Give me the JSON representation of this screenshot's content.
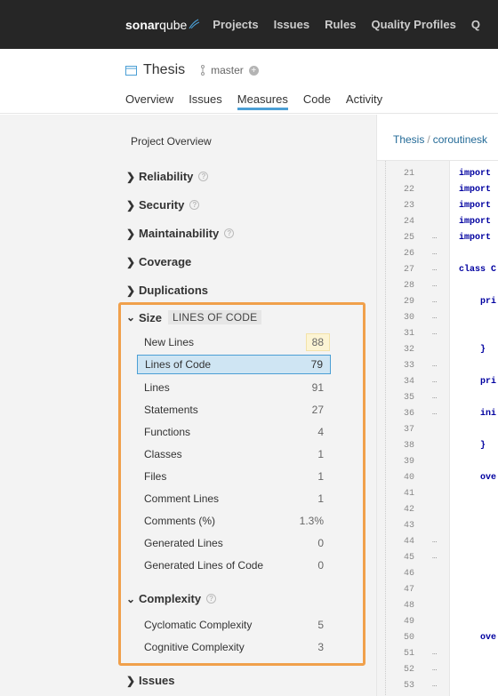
{
  "topnav": {
    "logo_bold": "sonar",
    "logo_rest": "qube",
    "items": [
      "Projects",
      "Issues",
      "Rules",
      "Quality Profiles",
      "Q"
    ]
  },
  "project": {
    "name": "Thesis",
    "branch": "master",
    "tabs": [
      "Overview",
      "Issues",
      "Measures",
      "Code",
      "Activity"
    ],
    "active_tab": "Measures"
  },
  "sidebar": {
    "title": "Project Overview",
    "categories_collapsed": [
      "Reliability",
      "Security",
      "Maintainability",
      "Coverage",
      "Duplications"
    ],
    "size": {
      "label": "Size",
      "badge": "LINES OF CODE",
      "metrics": [
        {
          "label": "New Lines",
          "value": "88"
        },
        {
          "label": "Lines of Code",
          "value": "79"
        },
        {
          "label": "Lines",
          "value": "91"
        },
        {
          "label": "Statements",
          "value": "27"
        },
        {
          "label": "Functions",
          "value": "4"
        },
        {
          "label": "Classes",
          "value": "1"
        },
        {
          "label": "Files",
          "value": "1"
        },
        {
          "label": "Comment Lines",
          "value": "1"
        },
        {
          "label": "Comments (%)",
          "value": "1.3%"
        },
        {
          "label": "Generated Lines",
          "value": "0"
        },
        {
          "label": "Generated Lines of Code",
          "value": "0"
        }
      ]
    },
    "complexity": {
      "label": "Complexity",
      "metrics": [
        {
          "label": "Cyclomatic Complexity",
          "value": "5"
        },
        {
          "label": "Cognitive Complexity",
          "value": "3"
        }
      ]
    },
    "issues_label": "Issues"
  },
  "breadcrumb": {
    "root": "Thesis",
    "sep": "/",
    "path": "coroutinesk"
  },
  "code": {
    "lines": [
      {
        "n": "21",
        "m": "",
        "t": "import"
      },
      {
        "n": "22",
        "m": "",
        "t": "import"
      },
      {
        "n": "23",
        "m": "",
        "t": "import"
      },
      {
        "n": "24",
        "m": "",
        "t": "import"
      },
      {
        "n": "25",
        "m": "…",
        "t": "import"
      },
      {
        "n": "26",
        "m": "…",
        "t": ""
      },
      {
        "n": "27",
        "m": "…",
        "t": "class C"
      },
      {
        "n": "28",
        "m": "…",
        "t": ""
      },
      {
        "n": "29",
        "m": "…",
        "t": "    pri"
      },
      {
        "n": "30",
        "m": "…",
        "t": ""
      },
      {
        "n": "31",
        "m": "…",
        "t": ""
      },
      {
        "n": "32",
        "m": "",
        "t": "    }"
      },
      {
        "n": "33",
        "m": "…",
        "t": ""
      },
      {
        "n": "34",
        "m": "…",
        "t": "    pri"
      },
      {
        "n": "35",
        "m": "…",
        "t": ""
      },
      {
        "n": "36",
        "m": "…",
        "t": "    ini"
      },
      {
        "n": "37",
        "m": "",
        "t": ""
      },
      {
        "n": "38",
        "m": "",
        "t": "    }"
      },
      {
        "n": "39",
        "m": "",
        "t": ""
      },
      {
        "n": "40",
        "m": "",
        "t": "    ove"
      },
      {
        "n": "41",
        "m": "",
        "t": ""
      },
      {
        "n": "42",
        "m": "",
        "t": ""
      },
      {
        "n": "43",
        "m": "",
        "t": ""
      },
      {
        "n": "44",
        "m": "…",
        "t": ""
      },
      {
        "n": "45",
        "m": "…",
        "t": ""
      },
      {
        "n": "46",
        "m": "",
        "t": ""
      },
      {
        "n": "47",
        "m": "",
        "t": ""
      },
      {
        "n": "48",
        "m": "",
        "t": ""
      },
      {
        "n": "49",
        "m": "",
        "t": ""
      },
      {
        "n": "50",
        "m": "",
        "t": "    ove"
      },
      {
        "n": "51",
        "m": "…",
        "t": ""
      },
      {
        "n": "52",
        "m": "…",
        "t": ""
      },
      {
        "n": "53",
        "m": "…",
        "t": ""
      }
    ]
  },
  "colors": {
    "topnav": "#262626",
    "accent": "#4b9fd5",
    "highlight_border": "#f0a04b",
    "new_value_bg": "#fcf4d4"
  }
}
